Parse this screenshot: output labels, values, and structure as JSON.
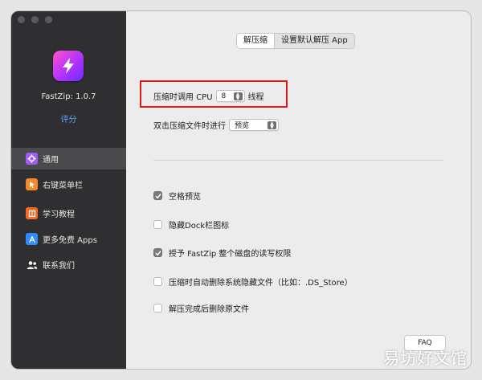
{
  "sidebar": {
    "app_name": "FastZip: 1.0.7",
    "rate_label": "评分",
    "items": [
      {
        "label": "通用",
        "icon": "gear-icon",
        "color": "#a15cf5"
      },
      {
        "label": "右键菜单栏",
        "icon": "cursor-icon",
        "color": "#f38b2a"
      },
      {
        "label": "学习教程",
        "icon": "book-icon",
        "color": "#f26b2a"
      },
      {
        "label": "更多免费 Apps",
        "icon": "app-store-icon",
        "color": "#2f8cff"
      },
      {
        "label": "联系我们",
        "icon": "people-icon",
        "color": "#ffffff"
      }
    ]
  },
  "tabs": [
    "解压缩",
    "设置默认解压 App"
  ],
  "settings": {
    "cpu_label": "压缩时调用 CPU",
    "cpu_value": "8",
    "cpu_suffix": "线程",
    "dblclick_label": "双击压缩文件时进行",
    "dblclick_value": "预览"
  },
  "checkboxes": [
    {
      "label": "空格预览",
      "checked": true
    },
    {
      "label": "隐藏Dock栏图标",
      "checked": false
    },
    {
      "label": "授予 FastZip 整个磁盘的读写权限",
      "checked": true
    },
    {
      "label": "压缩时自动删除系统隐藏文件（比如：.DS_Store）",
      "checked": false
    },
    {
      "label": "解压完成后删除原文件",
      "checked": false
    }
  ],
  "faq_label": "FAQ",
  "watermark": "易坊好文馆",
  "colors": {
    "highlight": "#e01818",
    "link": "#5fa7ff",
    "sidebar_bg": "#2f2f31"
  }
}
